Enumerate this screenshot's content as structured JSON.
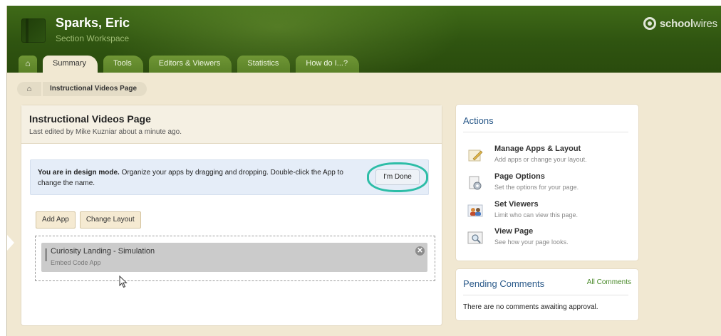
{
  "header": {
    "site_name": "Sparks, Eric",
    "site_sub": "Section Workspace",
    "brand_bold": "school",
    "brand_light": "wires"
  },
  "tabs": [
    {
      "label": "Summary",
      "active": true
    },
    {
      "label": "Tools"
    },
    {
      "label": "Editors & Viewers"
    },
    {
      "label": "Statistics"
    },
    {
      "label": "How do I...?"
    }
  ],
  "breadcrumb": {
    "current": "Instructional Videos Page"
  },
  "main": {
    "title": "Instructional Videos Page",
    "subtitle": "Last edited by Mike Kuzniar about a minute ago.",
    "design_bold": "You are in design mode.",
    "design_text": " Organize your apps by dragging and dropping. Double-click the App to change the name.",
    "done_button": "I'm Done",
    "add_app": "Add App",
    "change_layout": "Change Layout",
    "app": {
      "title": "Curiosity Landing - Simulation",
      "subtitle": "Embed Code App",
      "close": "✕"
    }
  },
  "actions": {
    "title": "Actions",
    "items": [
      {
        "title": "Manage Apps & Layout",
        "desc": "Add apps or change your layout.",
        "icon": "pencil-note-icon"
      },
      {
        "title": "Page Options",
        "desc": "Set the options for your page.",
        "icon": "page-gear-icon"
      },
      {
        "title": "Set Viewers",
        "desc": "Limit who can view this page.",
        "icon": "people-icon"
      },
      {
        "title": "View Page",
        "desc": "See how your page looks.",
        "icon": "magnifier-page-icon"
      }
    ]
  },
  "pending": {
    "title": "Pending Comments",
    "all_link": "All Comments",
    "empty_text": "There are no comments awaiting approval."
  },
  "colors": {
    "header_green": "#2f5410",
    "tab_green": "#5b8228",
    "page_bg": "#f1e8d2",
    "panel_title_blue": "#2b5a8a",
    "highlight_ring": "#2dbda7",
    "design_box_blue": "#e5edf8"
  }
}
